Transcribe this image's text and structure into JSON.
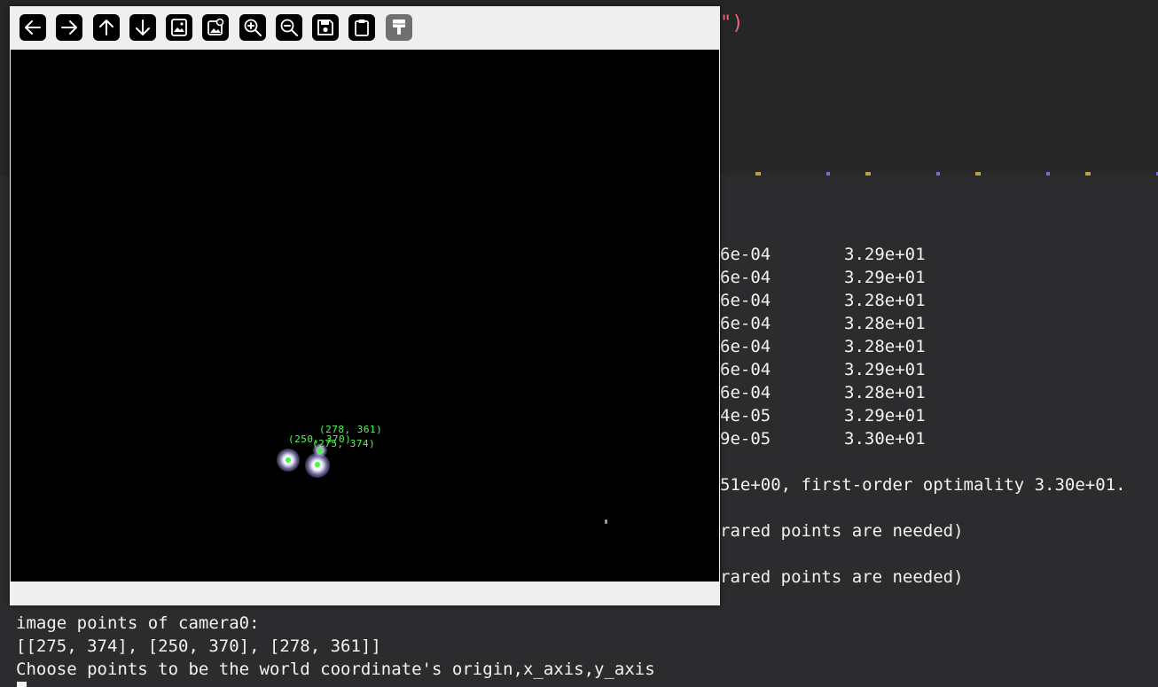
{
  "editor": {
    "snippet": "\")"
  },
  "terminal": {
    "rows": [
      {
        "c1": "6e-04",
        "c2": "3.29e+01"
      },
      {
        "c1": "6e-04",
        "c2": "3.29e+01"
      },
      {
        "c1": "6e-04",
        "c2": "3.28e+01"
      },
      {
        "c1": "6e-04",
        "c2": "3.28e+01"
      },
      {
        "c1": "6e-04",
        "c2": "3.28e+01"
      },
      {
        "c1": "6e-04",
        "c2": "3.29e+01"
      },
      {
        "c1": "6e-04",
        "c2": "3.28e+01"
      },
      {
        "c1": "4e-05",
        "c2": "3.29e+01"
      },
      {
        "c1": "9e-05",
        "c2": "3.30e+01"
      }
    ],
    "summary": "51e+00, first-order optimality 3.30e+01.",
    "warn1": "rared points are needed)",
    "warn2": "rared points are needed)",
    "bottom_line1": "image points of camera0:",
    "bottom_line2": "[[275, 374], [250, 370], [278, 361]]",
    "bottom_line3": "Choose points to be the world coordinate's origin,x_axis,y_axis"
  },
  "viewer": {
    "toolbar": [
      {
        "name": "back-arrow-icon"
      },
      {
        "name": "forward-arrow-icon"
      },
      {
        "name": "up-arrow-icon"
      },
      {
        "name": "down-arrow-icon"
      },
      {
        "name": "image-icon"
      },
      {
        "name": "image-properties-icon"
      },
      {
        "name": "zoom-in-icon"
      },
      {
        "name": "zoom-out-icon"
      },
      {
        "name": "save-icon"
      },
      {
        "name": "clipboard-icon"
      },
      {
        "name": "paint-brush-icon"
      }
    ],
    "annotations": {
      "p1": "(278, 361)",
      "p2": "(250, 370)",
      "p3": "(275, 374)"
    }
  }
}
